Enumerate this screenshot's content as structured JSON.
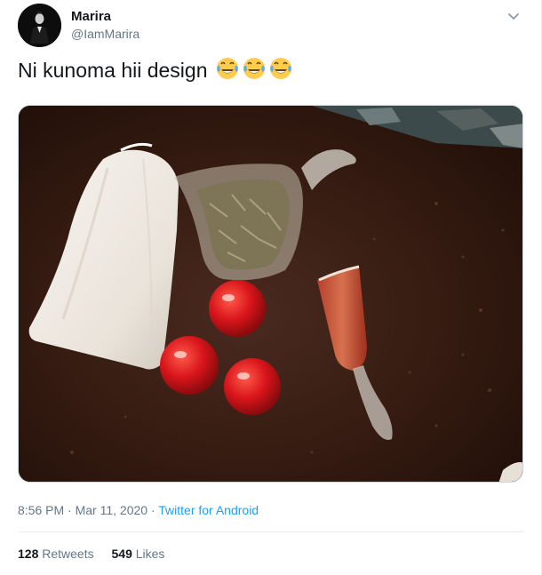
{
  "author": {
    "display_name": "Marira",
    "handle": "@IamMarira"
  },
  "tweet": {
    "text": "Ni kunoma hii design",
    "emoji": [
      "face-with-tears-of-joy",
      "face-with-tears-of-joy",
      "face-with-tears-of-joy"
    ]
  },
  "meta": {
    "time": "8:56 PM",
    "separator1": " · ",
    "date": "Mar 11, 2020",
    "separator2": " · ",
    "source": "Twitter for Android"
  },
  "stats": {
    "retweets_count": "128",
    "retweets_label": "Retweets",
    "likes_count": "549",
    "likes_label": "Likes"
  },
  "colors": {
    "link": "#1da1f2",
    "secondary_text": "#657786",
    "primary_text": "#14171a"
  }
}
